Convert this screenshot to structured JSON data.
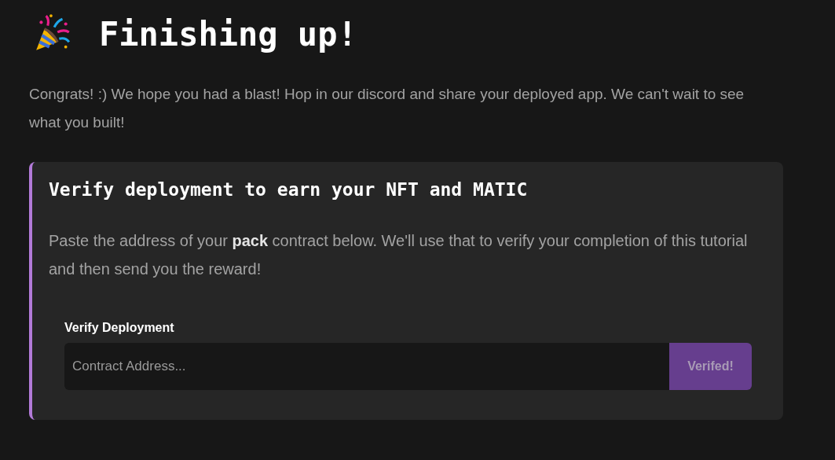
{
  "heading": {
    "title": "Finishing up!"
  },
  "intro": "Congrats! :) We hope you had a blast! Hop in our discord and share your deployed app. We can't wait to see what you built!",
  "card": {
    "title": "Verify deployment to earn your NFT and MATIC",
    "description": "Paste the address of your **pack** contract below. We'll use that to verify your completion of this tutorial and then send you the reward!",
    "form": {
      "label": "Verify Deployment",
      "placeholder": "Contract Address...",
      "button": {
        "label": "Verifed!",
        "disabled": true
      }
    }
  }
}
